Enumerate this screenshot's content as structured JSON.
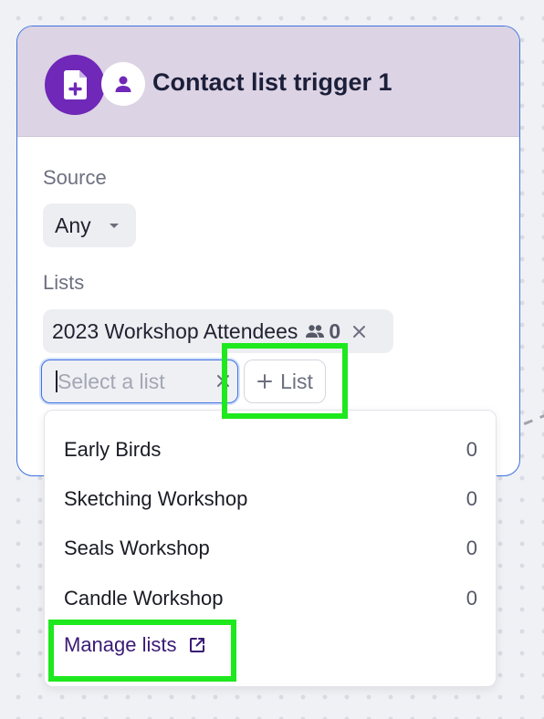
{
  "card": {
    "title": "Contact list trigger 1",
    "colors": {
      "header_bg": "#dcd3e4",
      "icon_bg": "#7028b8",
      "border": "#3f73e0"
    }
  },
  "source": {
    "label": "Source",
    "value": "Any"
  },
  "lists": {
    "label": "Lists",
    "selected": [
      {
        "name": "2023 Workshop Attendees",
        "count": "0"
      }
    ],
    "input_placeholder": "Select a list",
    "add_button_label": "List"
  },
  "dropdown": {
    "items": [
      {
        "name": "Early Birds",
        "count": "0"
      },
      {
        "name": "Sketching Workshop",
        "count": "0"
      },
      {
        "name": "Seals Workshop",
        "count": "0"
      },
      {
        "name": "Candle Workshop",
        "count": "0"
      }
    ],
    "manage_label": "Manage lists"
  },
  "icons": {
    "main": "file-add-icon",
    "contact": "person-icon",
    "people": "people-icon",
    "remove": "close-icon",
    "add": "plus-icon",
    "external": "external-link-icon"
  },
  "highlights": {
    "color": "#1ee81e"
  }
}
